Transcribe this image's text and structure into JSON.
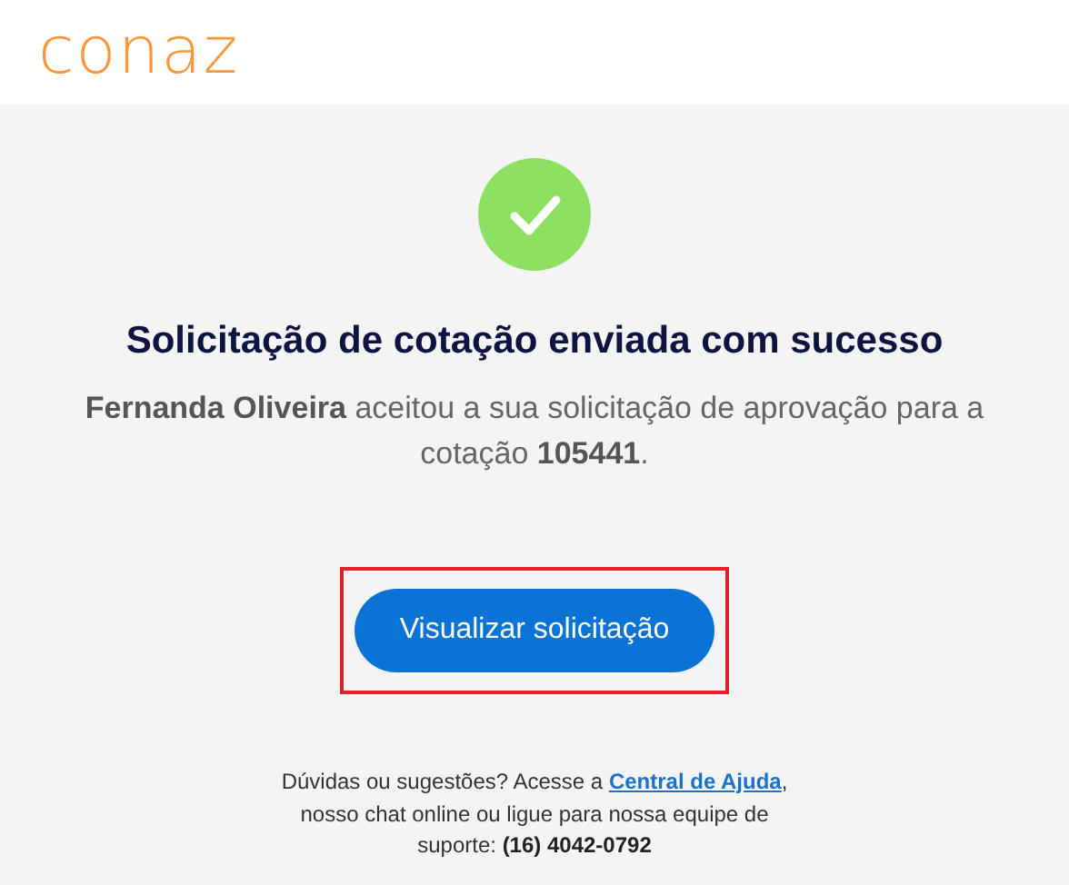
{
  "header": {
    "logo": "conaz"
  },
  "message": {
    "title": "Solicitação de cotação enviada com sucesso",
    "body": "**Fernanda Oliveira** aceitou a sua solicitação de aprovação para a cotação **105441**."
  },
  "button": {
    "label": "Visualizar solicitação",
    "highlighted": true
  },
  "footer": {
    "before": "Dúvidas ou sugestões? Acesse a ",
    "link": "Central de Ajuda",
    "after": ", nosso chat online ou ligue para nossa equipe de suporte: **(16) 4042-0792**"
  }
}
